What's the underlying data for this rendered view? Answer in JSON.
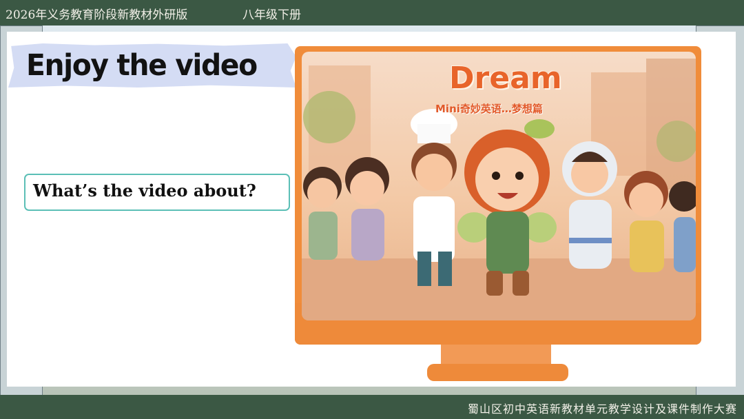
{
  "header": {
    "title": "2026年义务教育阶段新教材外研版",
    "grade": "八年级下册"
  },
  "footer": {
    "text": "蜀山区初中英语新教材单元教学设计及课件制作大赛"
  },
  "slide": {
    "heading": "Enjoy the video",
    "question": "What’s the video about?"
  },
  "video": {
    "title": "Dream",
    "subtitle": "Mini奇妙英语…梦想篇"
  },
  "colors": {
    "bar": "#3b5844",
    "monitor": "#f08c3a",
    "heading_tape": "#d4dcf4",
    "question_border": "#5bbfb6",
    "video_title": "#e8642a"
  }
}
